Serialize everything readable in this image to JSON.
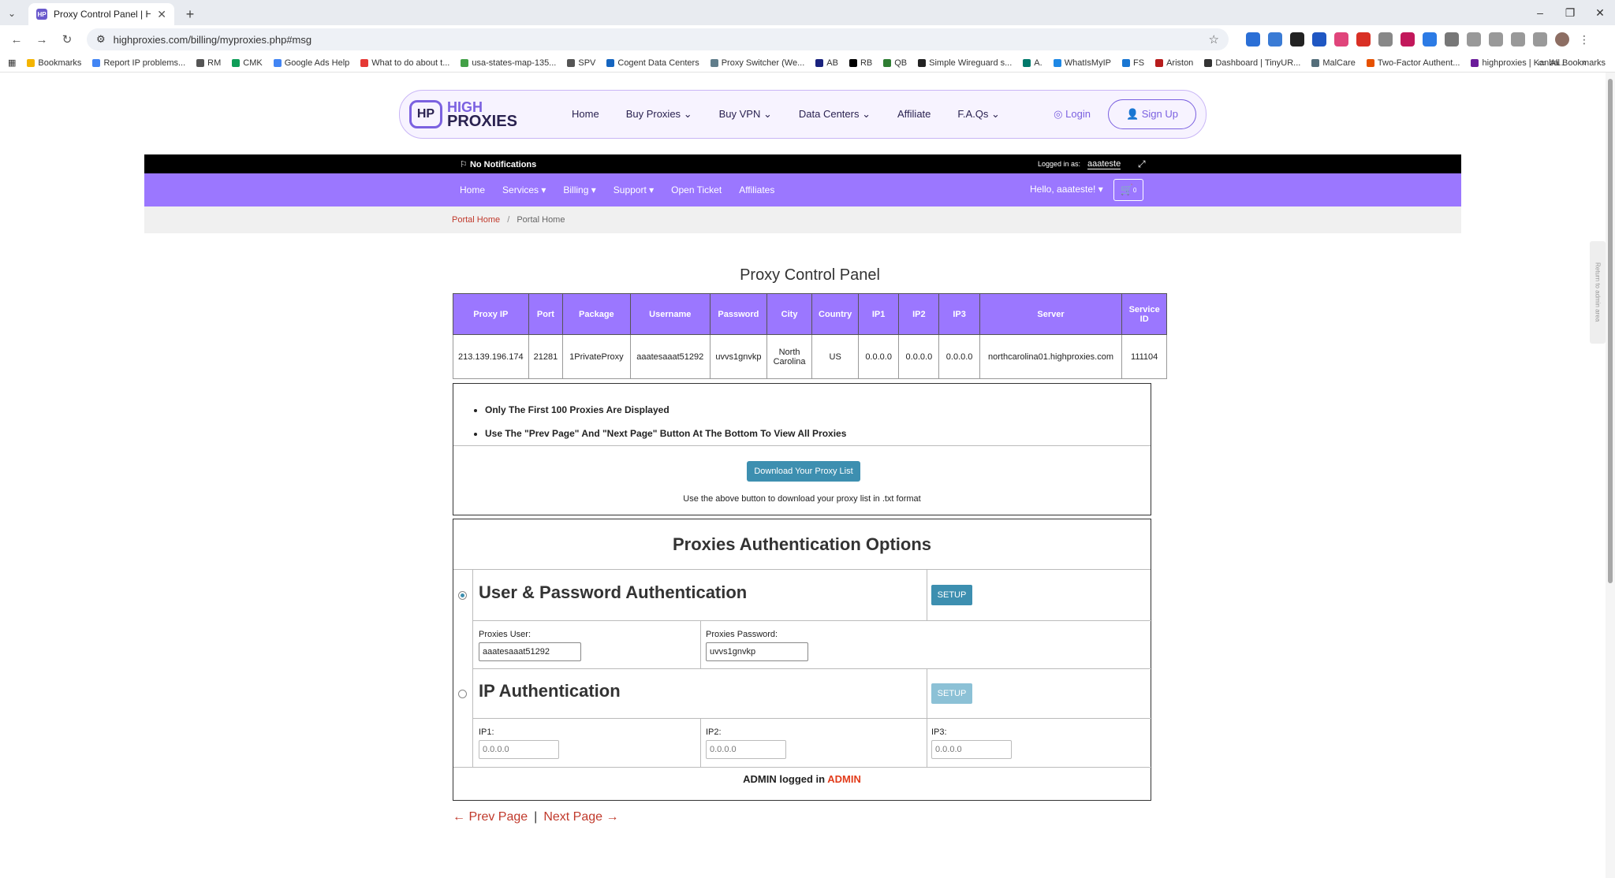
{
  "browser": {
    "tab_title": "Proxy Control Panel | High Prox",
    "url": "highproxies.com/billing/myproxies.php#msg",
    "bookmarks": [
      "Bookmarks",
      "Report IP problems...",
      "RM",
      "CMK",
      "Google Ads Help",
      "What to do about t...",
      "usa-states-map-135...",
      "SPV",
      "Cogent Data Centers",
      "Proxy Switcher (We...",
      "AB",
      "RB",
      "QB",
      "Simple Wireguard s...",
      "A.",
      "WhatIsMyIP",
      "FS",
      "Ariston",
      "Dashboard | TinyUR...",
      "MalCare",
      "Two-Factor Authent...",
      "highproxies | Kanba..."
    ],
    "all_bookmarks": "All Bookmarks"
  },
  "site": {
    "logo_line1": "HIGH",
    "logo_line2": "PROXIES",
    "logo_mark": "HP",
    "nav": [
      "Home",
      "Buy Proxies",
      "Buy VPN",
      "Data Centers",
      "Affiliate",
      "F.A.Qs"
    ],
    "login": "Login",
    "signup": "Sign Up"
  },
  "notif": {
    "no_notifications": "No Notifications",
    "logged_in_as": "Logged in as:",
    "user": "aaateste"
  },
  "client_nav": {
    "items": [
      "Home",
      "Services",
      "Billing",
      "Support",
      "Open Ticket",
      "Affiliates"
    ],
    "hello": "Hello, aaateste!",
    "cart_count": "0"
  },
  "breadcrumb": {
    "home": "Portal Home",
    "current": "Portal Home"
  },
  "panel": {
    "title": "Proxy Control Panel",
    "headers": [
      "Proxy IP",
      "Port",
      "Package",
      "Username",
      "Password",
      "City",
      "Country",
      "IP1",
      "IP2",
      "IP3",
      "Server",
      "Service ID"
    ],
    "row": [
      "213.139.196.174",
      "21281",
      "1PrivateProxy",
      "aaatesaaat51292",
      "uvvs1gnvkp",
      "North Carolina",
      "US",
      "0.0.0.0",
      "0.0.0.0",
      "0.0.0.0",
      "northcarolina01.highproxies.com",
      "111104"
    ]
  },
  "info": {
    "bullets": [
      "Only The First 100 Proxies Are Displayed",
      "Use The \"Prev Page\" And \"Next Page\" Button At The Bottom To View All Proxies"
    ],
    "download_button": "Download Your Proxy List",
    "download_note": "Use the above button to download your proxy list in .txt format"
  },
  "auth": {
    "title": "Proxies Authentication Options",
    "user_pass_heading": "User & Password Authentication",
    "ip_heading": "IP Authentication",
    "setup_label": "SETUP",
    "proxies_user_label": "Proxies User:",
    "proxies_user_value": "aaatesaaat51292",
    "proxies_password_label": "Proxies Password:",
    "proxies_password_value": "uvvs1gnvkp",
    "ip1_label": "IP1:",
    "ip2_label": "IP2:",
    "ip3_label": "IP3:",
    "ip_placeholder": "0.0.0.0",
    "admin_prefix": "ADMIN logged in",
    "admin_name": "ADMIN"
  },
  "pager": {
    "prev": "← Prev Page",
    "separator": "|",
    "next": "Next Page →"
  },
  "side_tab": "Return to admin area"
}
